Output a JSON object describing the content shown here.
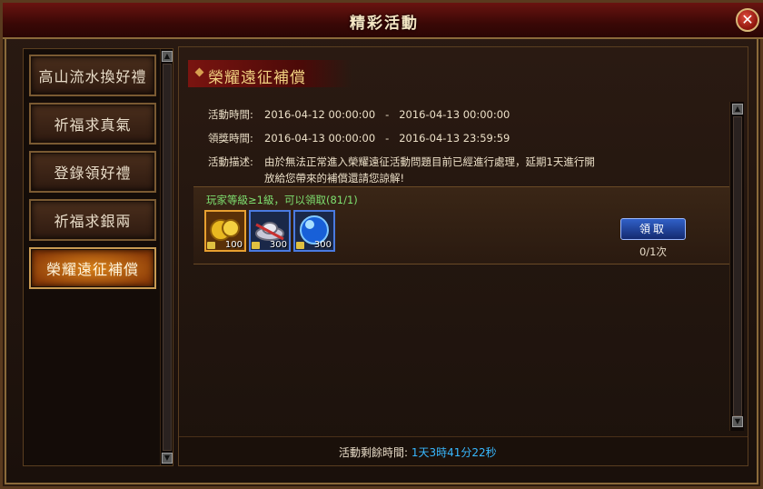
{
  "window": {
    "title": "精彩活動"
  },
  "sidebar": {
    "items": [
      {
        "label": "高山流水換好禮",
        "active": false
      },
      {
        "label": "祈福求真氣",
        "active": false
      },
      {
        "label": "登錄領好禮",
        "active": false
      },
      {
        "label": "祈福求銀兩",
        "active": false
      },
      {
        "label": "榮耀遠征補償",
        "active": true
      }
    ]
  },
  "event": {
    "title": "榮耀遠征補償",
    "activity_time_label": "活動時間:",
    "activity_time_value": "2016-04-12 00:00:00   -   2016-04-13 00:00:00",
    "claim_time_label": "領獎時間:",
    "claim_time_value": "2016-04-13 00:00:00   -   2016-04-13 23:59:59",
    "desc_label": "活動描述:",
    "desc_line1": "由於無法正常進入榮耀遠征活動問題目前已經進行處理，延期1天進行開",
    "desc_line2": "放給您帶來的補償還請您諒解!"
  },
  "reward": {
    "requirement": "玩家等級≥1級，可以領取(81/1)",
    "items": [
      {
        "icon": "gold-coins-icon",
        "count": "100"
      },
      {
        "icon": "silver-ingot-icon",
        "count": "300"
      },
      {
        "icon": "blue-orb-icon",
        "count": "300"
      }
    ],
    "claim_label": "領取",
    "claim_count": "0/1次"
  },
  "footer": {
    "remaining_label": "活動剩餘時間:",
    "remaining_value": "1天3時41分22秒"
  }
}
